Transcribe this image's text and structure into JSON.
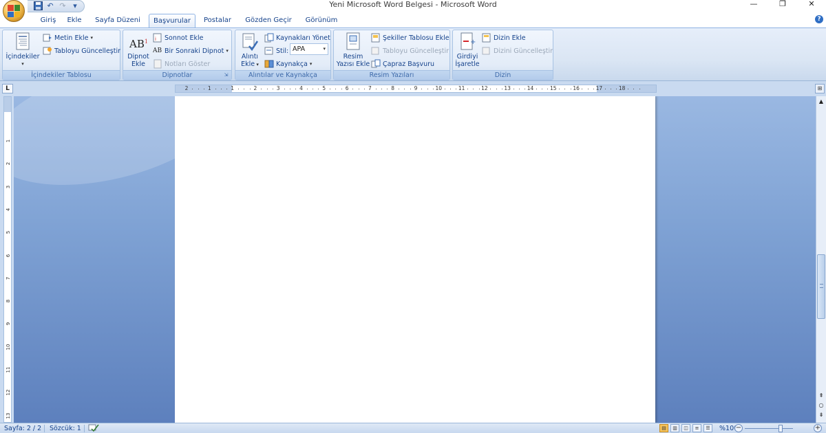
{
  "window": {
    "title": "Yeni Microsoft Word Belgesi - Microsoft Word",
    "minimize": "—",
    "restore": "❐",
    "close": "✕"
  },
  "quick_access": {
    "save_icon": "save-icon",
    "undo_icon": "undo-icon",
    "redo_icon": "redo-icon",
    "customize": "▾"
  },
  "tabs": [
    {
      "label": "Giriş"
    },
    {
      "label": "Ekle"
    },
    {
      "label": "Sayfa Düzeni"
    },
    {
      "label": "Başvurular",
      "active": true
    },
    {
      "label": "Postalar"
    },
    {
      "label": "Gözden Geçir"
    },
    {
      "label": "Görünüm"
    }
  ],
  "help": "?",
  "ribbon": {
    "toc": {
      "group_label": "İçindekiler Tablosu",
      "toc_button": "İçindekiler",
      "add_text": "Metin Ekle",
      "update_table": "Tabloyu Güncelleştir"
    },
    "footnotes": {
      "group_label": "Dipnotlar",
      "insert_footnote_line1": "Dipnot",
      "insert_footnote_line2": "Ekle",
      "insert_endnote": "Sonnot Ekle",
      "next_footnote": "Bir Sonraki Dipnot",
      "show_notes": "Notları Göster"
    },
    "citations": {
      "group_label": "Alıntılar ve Kaynakça",
      "insert_citation_line1": "Alıntı",
      "insert_citation_line2": "Ekle",
      "manage_sources": "Kaynakları Yönet",
      "style_label": "Stil:",
      "style_value": "APA",
      "bibliography": "Kaynakça"
    },
    "captions": {
      "group_label": "Resim Yazıları",
      "insert_caption_line1": "Resim",
      "insert_caption_line2": "Yazısı Ekle",
      "insert_table_of_figures": "Şekiller Tablosu Ekle",
      "update_table": "Tabloyu Güncelleştir",
      "cross_reference": "Çapraz Başvuru"
    },
    "index": {
      "group_label": "Dizin",
      "mark_entry_line1": "Girdiyi",
      "mark_entry_line2": "İşaretle",
      "insert_index": "Dizin Ekle",
      "update_index": "Dizini Güncelleştir"
    }
  },
  "ruler": {
    "tab_selector": "L",
    "numbers": [
      "2",
      "1",
      "1",
      "2",
      "3",
      "4",
      "5",
      "6",
      "7",
      "8",
      "9",
      "10",
      "11",
      "12",
      "13",
      "14",
      "15",
      "16",
      "17",
      "18"
    ],
    "vertical_numbers": [
      "1",
      "2",
      "3",
      "4",
      "5",
      "6",
      "7",
      "8",
      "9",
      "10",
      "11",
      "12",
      "13"
    ]
  },
  "status": {
    "page": "Sayfa: 2 / 2",
    "words": "Sözcük: 1",
    "zoom": "%100",
    "zoom_minus": "−",
    "zoom_plus": "+"
  }
}
